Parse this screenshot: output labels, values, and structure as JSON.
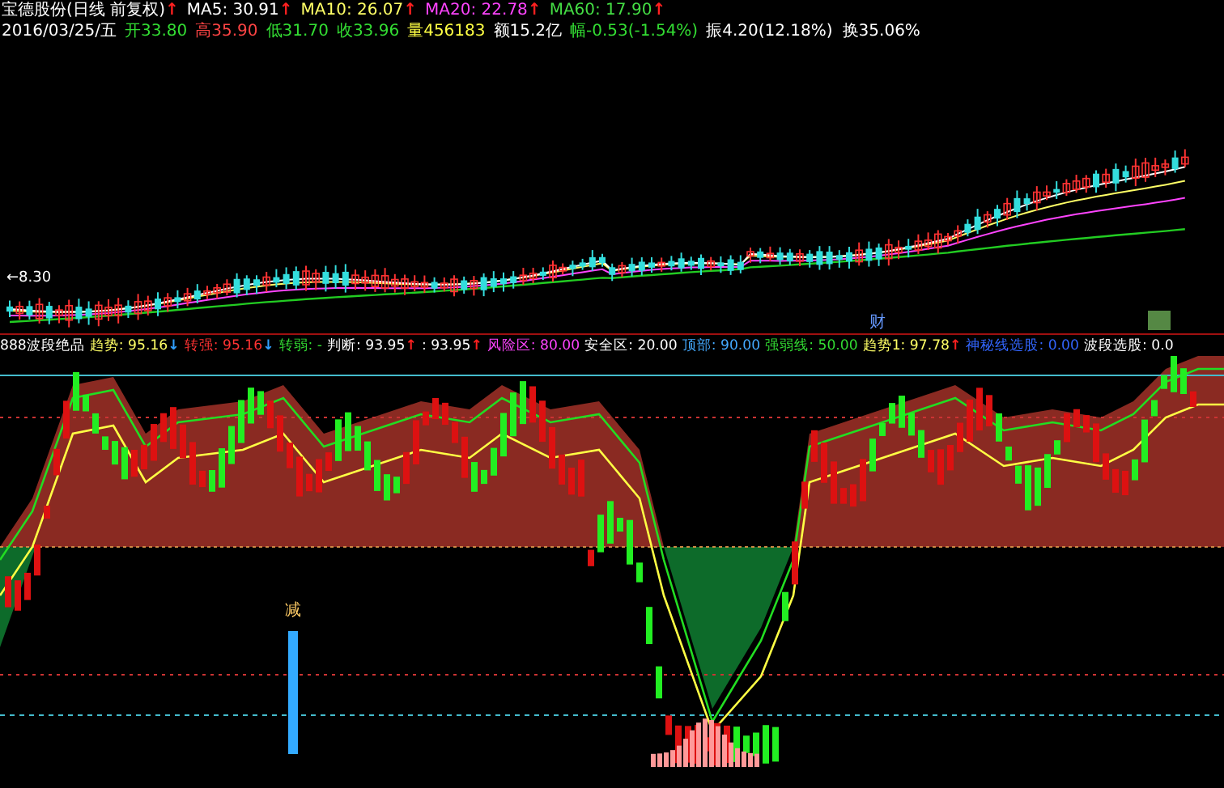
{
  "header": {
    "title": "宝德股份(日线 前复权)",
    "arrow": {
      "text": "↑",
      "color": "#ff2020"
    },
    "ma": [
      {
        "label": "MA5: 30.91",
        "color": "#ffffff",
        "arrow": {
          "text": "↑",
          "color": "#ff2020"
        }
      },
      {
        "label": "MA10: 26.07",
        "color": "#ffff66",
        "arrow": {
          "text": "↑",
          "color": "#ff2020"
        }
      },
      {
        "label": "MA20: 22.78",
        "color": "#ff44ff",
        "arrow": {
          "text": "↑",
          "color": "#ff2020"
        }
      },
      {
        "label": "MA60: 17.90",
        "color": "#44dd44",
        "arrow": {
          "text": "↑",
          "color": "#ff2020"
        }
      }
    ]
  },
  "quote": [
    {
      "text": "2016/03/25/五",
      "color": "#ffffff"
    },
    {
      "text": "开33.80",
      "color": "#33dd33"
    },
    {
      "text": "高35.90",
      "color": "#ff4444"
    },
    {
      "text": "低31.70",
      "color": "#33dd33"
    },
    {
      "text": "收33.96",
      "color": "#33dd33"
    },
    {
      "text": "量456183",
      "color": "#ffff44"
    },
    {
      "text": "额15.2亿",
      "color": "#ffffff"
    },
    {
      "text": "幅-0.53(-1.54%)",
      "color": "#33dd33"
    },
    {
      "text": "振4.20(12.18%)",
      "color": "#ffffff"
    },
    {
      "text": "换35.06%",
      "color": "#ffffff"
    }
  ],
  "price_chart": {
    "low_label": "←8.30",
    "markers": [
      {
        "text": "财"
      }
    ]
  },
  "indicator": {
    "labels": [
      {
        "text": "888波段绝品",
        "color": "#ffffff"
      },
      {
        "text": "趋势: 95.16",
        "color": "#ffff66",
        "arrow": {
          "text": "↓",
          "color": "#30a0ff"
        }
      },
      {
        "text": "转强: 95.16",
        "color": "#ff3333",
        "arrow": {
          "text": "↓",
          "color": "#30a0ff"
        }
      },
      {
        "text": "转弱: -",
        "color": "#33dd33"
      },
      {
        "text": "判断: 93.95",
        "color": "#ffffff",
        "arrow": {
          "text": "↑",
          "color": "#ff2020"
        }
      },
      {
        "text": ": 93.95",
        "color": "#ffffff",
        "arrow": {
          "text": "↑",
          "color": "#ff2020"
        }
      },
      {
        "text": "风险区: 80.00",
        "color": "#ff44ff"
      },
      {
        "text": "安全区: 20.00",
        "color": "#ffffff"
      },
      {
        "text": "顶部: 90.00",
        "color": "#44aaff"
      },
      {
        "text": "强弱线: 50.00",
        "color": "#33dd33"
      },
      {
        "text": "趋势1: 97.78",
        "color": "#ffff66",
        "arrow": {
          "text": "↑",
          "color": "#ff2020"
        }
      },
      {
        "text": "神秘线选股: 0.00",
        "color": "#3366ff"
      },
      {
        "text": "波段选股: 0.0",
        "color": "#ffffff"
      }
    ],
    "marker": "减"
  }
}
